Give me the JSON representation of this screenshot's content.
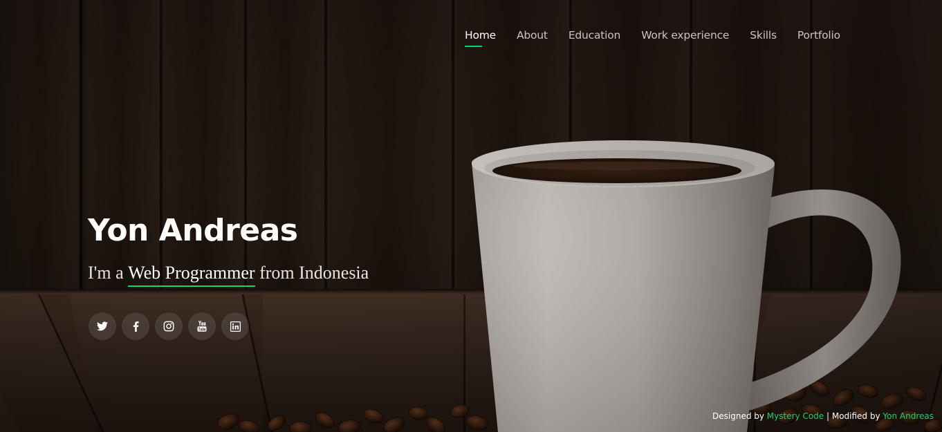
{
  "nav": {
    "items": [
      {
        "label": "Home",
        "active": true
      },
      {
        "label": "About",
        "active": false
      },
      {
        "label": "Education",
        "active": false
      },
      {
        "label": "Work experience",
        "active": false
      },
      {
        "label": "Skills",
        "active": false
      },
      {
        "label": "Portfolio",
        "active": false
      }
    ]
  },
  "hero": {
    "name": "Yon Andreas",
    "tagline_prefix": "I'm a ",
    "tagline_typed": "Web Programmer",
    "tagline_suffix": " from Indonesia"
  },
  "social": [
    {
      "icon": "twitter-icon"
    },
    {
      "icon": "facebook-icon"
    },
    {
      "icon": "instagram-icon"
    },
    {
      "icon": "youtube-icon"
    },
    {
      "icon": "linkedin-icon"
    }
  ],
  "credits": {
    "designed_prefix": "Designed by ",
    "designer": "Mystery Code",
    "separator": " | ",
    "modified_prefix": "Modified by ",
    "modifier": "Yon Andreas"
  },
  "colors": {
    "accent": "#18d26e",
    "text": "#ffffff",
    "nav_text": "#c9c5c2"
  }
}
